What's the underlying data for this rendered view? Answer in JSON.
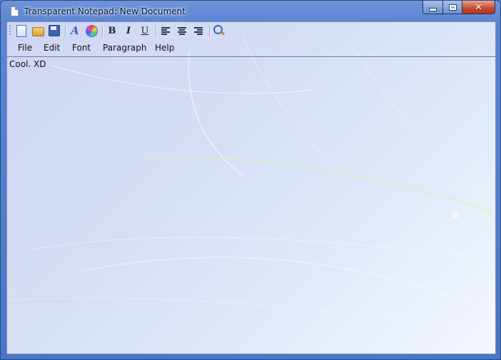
{
  "window": {
    "title": "Transparent Notepad: New Document",
    "caption": {
      "minimize": "minimize",
      "maximize": "maximize",
      "close": "close"
    }
  },
  "toolbar": {
    "icons": [
      "new-document-icon",
      "open-folder-icon",
      "save-icon",
      "font-icon",
      "color-icon",
      "bold-icon",
      "italic-icon",
      "underline-icon",
      "align-left-icon",
      "align-center-icon",
      "align-right-icon",
      "find-icon"
    ],
    "bold_label": "B",
    "italic_label": "I",
    "underline_label": "U",
    "font_label": "A"
  },
  "menu": {
    "items": [
      {
        "label": "File"
      },
      {
        "label": "Edit"
      },
      {
        "label": "Font"
      },
      {
        "label": "Paragraph"
      },
      {
        "label": "Help"
      }
    ]
  },
  "document": {
    "text": "Cool. XD"
  },
  "colors": {
    "frame": "#5b86d3",
    "client_background": "#d6def5",
    "close_button": "#c6472b"
  }
}
